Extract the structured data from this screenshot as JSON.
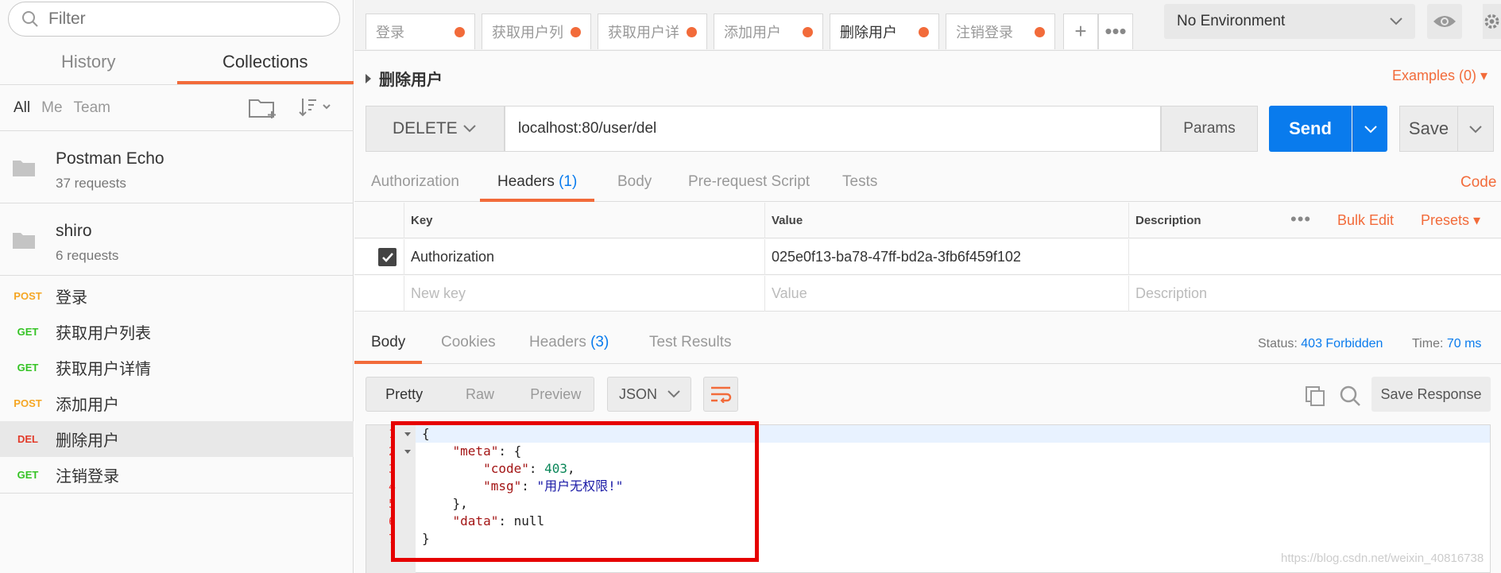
{
  "sidebar": {
    "filter_placeholder": "Filter",
    "tabs": [
      "History",
      "Collections"
    ],
    "scope": [
      "All",
      "Me",
      "Team"
    ],
    "collections": [
      {
        "name": "Postman Echo",
        "count": "37 requests"
      },
      {
        "name": "shiro",
        "count": "6 requests"
      }
    ],
    "requests": [
      {
        "method": "POST",
        "name": "登录"
      },
      {
        "method": "GET",
        "name": "获取用户列表"
      },
      {
        "method": "GET",
        "name": "获取用户详情"
      },
      {
        "method": "POST",
        "name": "添加用户"
      },
      {
        "method": "DEL",
        "name": "删除用户"
      },
      {
        "method": "GET",
        "name": "注销登录"
      }
    ]
  },
  "tabs": [
    "登录",
    "获取用户列",
    "获取用户详",
    "添加用户",
    "删除用户",
    "注销登录"
  ],
  "environment": "No Environment",
  "request": {
    "title": "删除用户",
    "examples": "Examples (0)",
    "method": "DELETE",
    "url": "localhost:80/user/del",
    "params_label": "Params",
    "send_label": "Send",
    "save_label": "Save"
  },
  "sub_tabs": {
    "authorization": "Authorization",
    "headers": "Headers",
    "headers_count": "(1)",
    "body": "Body",
    "prerequest": "Pre-request Script",
    "tests": "Tests",
    "code": "Code"
  },
  "headers_table": {
    "col_key": "Key",
    "col_value": "Value",
    "col_desc": "Description",
    "bulk_edit": "Bulk Edit",
    "presets": "Presets",
    "row": {
      "key": "Authorization",
      "value": "025e0f13-ba78-47ff-bd2a-3fb6f459f102"
    },
    "new_key": "New key",
    "new_value": "Value",
    "new_desc": "Description"
  },
  "response": {
    "tabs": {
      "body": "Body",
      "cookies": "Cookies",
      "headers": "Headers",
      "headers_count": "(3)",
      "tests": "Test Results"
    },
    "status_label": "Status:",
    "status_value": "403 Forbidden",
    "time_label": "Time:",
    "time_value": "70 ms",
    "view_options": [
      "Pretty",
      "Raw",
      "Preview"
    ],
    "format": "JSON",
    "save_response": "Save Response",
    "json_lines": [
      "{",
      "\"meta\": {",
      "\"code\": 403,",
      "\"msg\": \"用户无权限!\"",
      "},",
      "\"data\": null",
      "}"
    ],
    "json": {
      "code": "403",
      "msg": "\"用户无权限!\"",
      "data": "null"
    }
  },
  "watermark": "https://blog.csdn.net/weixin_40816738",
  "colors": {
    "accent": "#f26b3a",
    "primary": "#097bed",
    "highlight": "#e60000"
  }
}
